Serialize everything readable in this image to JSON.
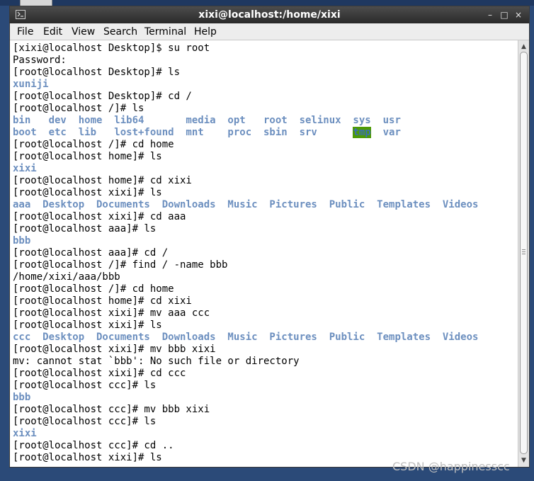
{
  "window": {
    "title": "xixi@localhost:/home/xixi",
    "controls": {
      "minimize": "–",
      "maximize": "□",
      "close": "×"
    }
  },
  "menubar": {
    "items": [
      "File",
      "Edit",
      "View",
      "Search",
      "Terminal",
      "Help"
    ]
  },
  "terminal": {
    "lines": [
      [
        {
          "t": "[xixi@localhost Desktop]$ su root"
        }
      ],
      [
        {
          "t": "Password:"
        }
      ],
      [
        {
          "t": "[root@localhost Desktop]# ls"
        }
      ],
      [
        {
          "t": "xuniji",
          "c": "blue"
        }
      ],
      [
        {
          "t": "[root@localhost Desktop]# cd /"
        }
      ],
      [
        {
          "t": "[root@localhost /]# ls"
        }
      ],
      [
        {
          "t": "bin   dev  home  lib64       media  opt   root  selinux  sys  usr",
          "c": "blue"
        }
      ],
      [
        {
          "t": "boot  etc  lib   lost+found  mnt    proc  sbin  srv      ",
          "c": "blue"
        },
        {
          "t": "tmp",
          "c": "hl"
        },
        {
          "t": "  var",
          "c": "blue"
        }
      ],
      [
        {
          "t": "[root@localhost /]# cd home"
        }
      ],
      [
        {
          "t": "[root@localhost home]# ls"
        }
      ],
      [
        {
          "t": "xixi",
          "c": "blue"
        }
      ],
      [
        {
          "t": "[root@localhost home]# cd xixi"
        }
      ],
      [
        {
          "t": "[root@localhost xixi]# ls"
        }
      ],
      [
        {
          "t": "aaa  Desktop  Documents  Downloads  Music  Pictures  Public  Templates  Videos",
          "c": "blue"
        }
      ],
      [
        {
          "t": "[root@localhost xixi]# cd aaa"
        }
      ],
      [
        {
          "t": "[root@localhost aaa]# ls"
        }
      ],
      [
        {
          "t": "bbb",
          "c": "blue"
        }
      ],
      [
        {
          "t": "[root@localhost aaa]# cd /"
        }
      ],
      [
        {
          "t": "[root@localhost /]# find / -name bbb"
        }
      ],
      [
        {
          "t": "/home/xixi/aaa/bbb"
        }
      ],
      [
        {
          "t": "[root@localhost /]# cd home"
        }
      ],
      [
        {
          "t": "[root@localhost home]# cd xixi"
        }
      ],
      [
        {
          "t": "[root@localhost xixi]# mv aaa ccc"
        }
      ],
      [
        {
          "t": "[root@localhost xixi]# ls"
        }
      ],
      [
        {
          "t": "ccc  Desktop  Documents  Downloads  Music  Pictures  Public  Templates  Videos",
          "c": "blue"
        }
      ],
      [
        {
          "t": "[root@localhost xixi]# mv bbb xixi"
        }
      ],
      [
        {
          "t": "mv: cannot stat `bbb': No such file or directory"
        }
      ],
      [
        {
          "t": "[root@localhost xixi]# cd ccc"
        }
      ],
      [
        {
          "t": "[root@localhost ccc]# ls"
        }
      ],
      [
        {
          "t": "bbb",
          "c": "blue"
        }
      ],
      [
        {
          "t": "[root@localhost ccc]# mv bbb xixi"
        }
      ],
      [
        {
          "t": "[root@localhost ccc]# ls"
        }
      ],
      [
        {
          "t": "xixi",
          "c": "blue"
        }
      ],
      [
        {
          "t": "[root@localhost ccc]# cd .."
        }
      ],
      [
        {
          "t": "[root@localhost xixi]# ls"
        }
      ]
    ]
  },
  "colors": {
    "directory": "#6c8fbf",
    "sticky_dir_bg": "#4d9a06",
    "titlebar": "#333333"
  },
  "watermark": "CSDN @happinesscc"
}
